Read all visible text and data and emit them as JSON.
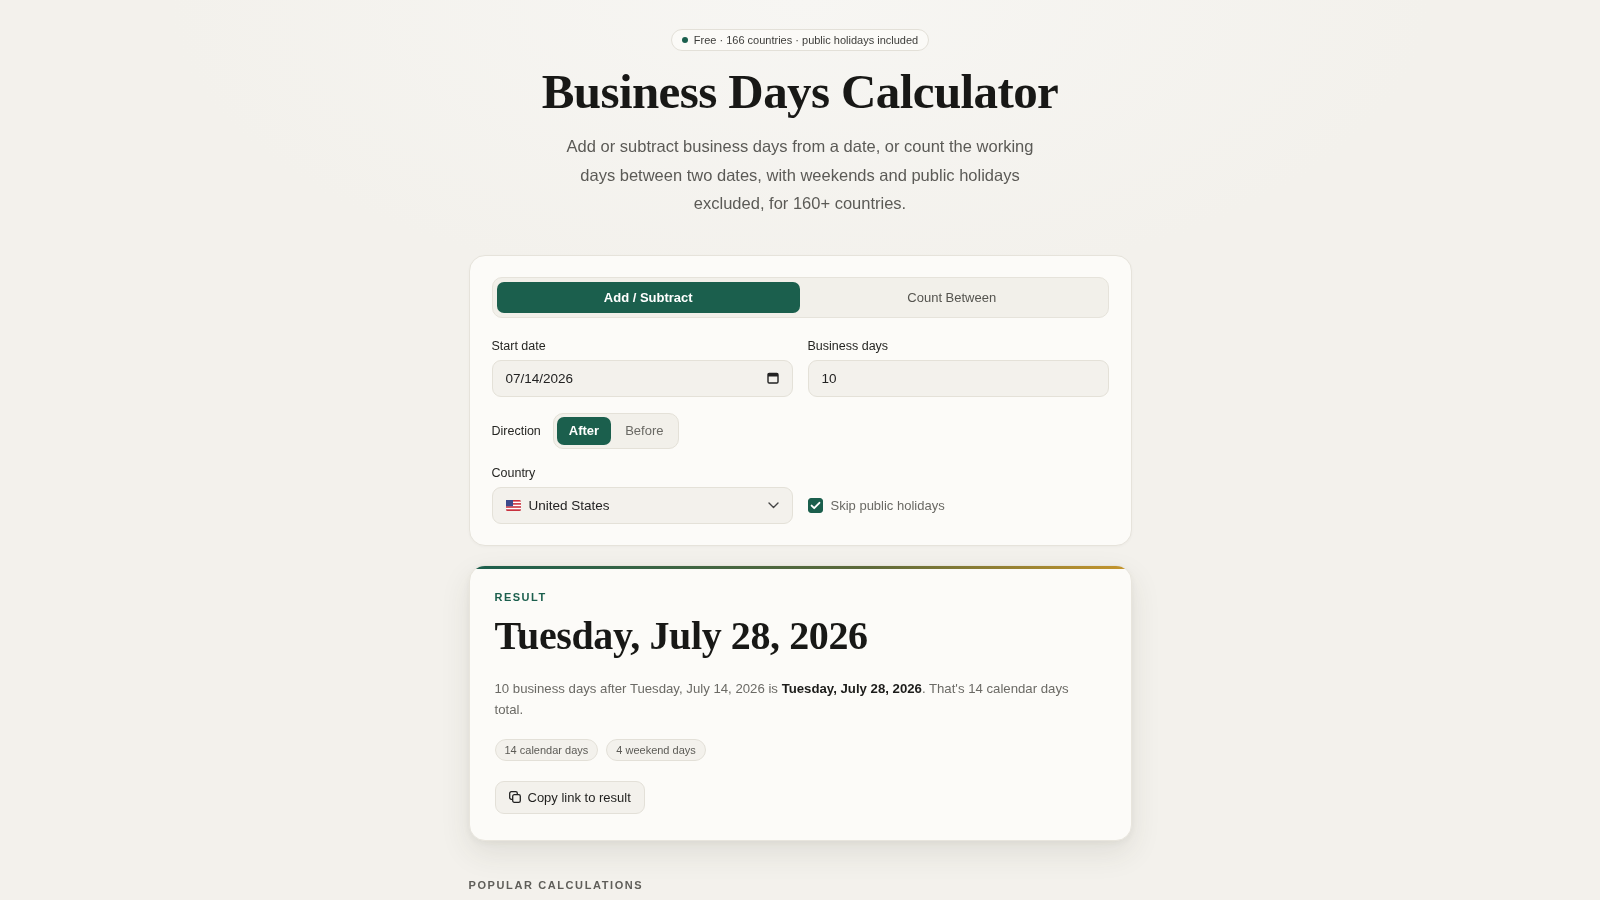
{
  "badge": {
    "text": "Free · 166 countries · public holidays included"
  },
  "title": "Business Days Calculator",
  "subtitle": "Add or subtract business days from a date, or count the working days between two dates, with weekends and public holidays excluded, for 160+ countries.",
  "calculator": {
    "mode_tabs": [
      {
        "label": "Add / Subtract",
        "selected": true
      },
      {
        "label": "Count Between",
        "selected": false
      }
    ],
    "start_date": {
      "label": "Start date",
      "value": "07/14/2026"
    },
    "business_days": {
      "label": "Business days",
      "value": "10"
    },
    "direction": {
      "label": "Direction",
      "options": [
        {
          "label": "After",
          "selected": true
        },
        {
          "label": "Before",
          "selected": false
        }
      ]
    },
    "country": {
      "label": "Country",
      "value": "United States"
    },
    "skip_holidays": {
      "label": "Skip public holidays",
      "checked": true
    }
  },
  "result": {
    "heading": "RESULT",
    "date": "Tuesday, July 28, 2026",
    "summary": "10 business days after Tuesday, July 14, 2026 is **Tuesday, July 28, 2026**. That's 14 calendar days total.",
    "chips": [
      "14 calendar days",
      "4 weekend days"
    ],
    "copy_button": "Copy link to result"
  },
  "section_heading": "POPULAR CALCULATIONS"
}
